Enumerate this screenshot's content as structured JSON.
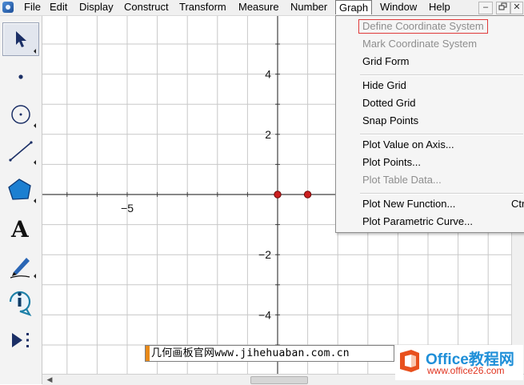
{
  "menubar": {
    "items": [
      "File",
      "Edit",
      "Display",
      "Construct",
      "Transform",
      "Measure",
      "Number",
      "Graph",
      "Window",
      "Help"
    ],
    "active": "Graph",
    "window_buttons": [
      "–",
      "🗗",
      "✕"
    ]
  },
  "toolbar": {
    "tools": [
      {
        "name": "arrow-select-tool",
        "icon": "arrow-icon",
        "selected": true
      },
      {
        "name": "point-tool",
        "icon": "point-icon"
      },
      {
        "name": "compass-tool",
        "icon": "circle-icon"
      },
      {
        "name": "straightedge-tool",
        "icon": "segment-icon"
      },
      {
        "name": "polygon-tool",
        "icon": "polygon-icon"
      },
      {
        "name": "text-tool",
        "icon": "text-a-icon"
      },
      {
        "name": "marker-tool",
        "icon": "pen-icon"
      },
      {
        "name": "information-tool",
        "icon": "info-icon"
      },
      {
        "name": "custom-tool",
        "icon": "play-dots-icon"
      }
    ],
    "text_tool_glyph": "A"
  },
  "graph": {
    "x_tick_labels": [
      "−5"
    ],
    "y_tick_labels": [
      "4",
      "2",
      "−2",
      "−4"
    ],
    "points": [
      {
        "x": 0,
        "y": 0
      },
      {
        "x": 1,
        "y": 0
      }
    ],
    "colors": {
      "grid": "#c8c8c8",
      "axis": "#404040",
      "point": "#cc1f1f"
    }
  },
  "graph_menu": {
    "items": [
      {
        "label": "Define Coordinate System",
        "state": "disabled",
        "highlighted": true
      },
      {
        "label": "Mark Coordinate System",
        "state": "disabled"
      },
      {
        "label": "Grid Form",
        "state": "enabled"
      },
      {
        "separator": true
      },
      {
        "label": "Hide Grid",
        "state": "enabled"
      },
      {
        "label": "Dotted Grid",
        "state": "enabled"
      },
      {
        "label": "Snap Points",
        "state": "enabled"
      },
      {
        "separator": true
      },
      {
        "label": "Plot Value on Axis...",
        "state": "enabled"
      },
      {
        "label": "Plot Points...",
        "state": "enabled"
      },
      {
        "label": "Plot Table Data...",
        "state": "disabled"
      },
      {
        "separator": true
      },
      {
        "label": "Plot New Function...",
        "state": "enabled",
        "shortcut": "Ctr"
      },
      {
        "label": "Plot Parametric Curve...",
        "state": "enabled"
      }
    ]
  },
  "watermark": {
    "text": "几何画板官网www.jihehuaban.com.cn"
  },
  "office_logo": {
    "brand": "Office教程网",
    "site": "www.office26.com"
  }
}
